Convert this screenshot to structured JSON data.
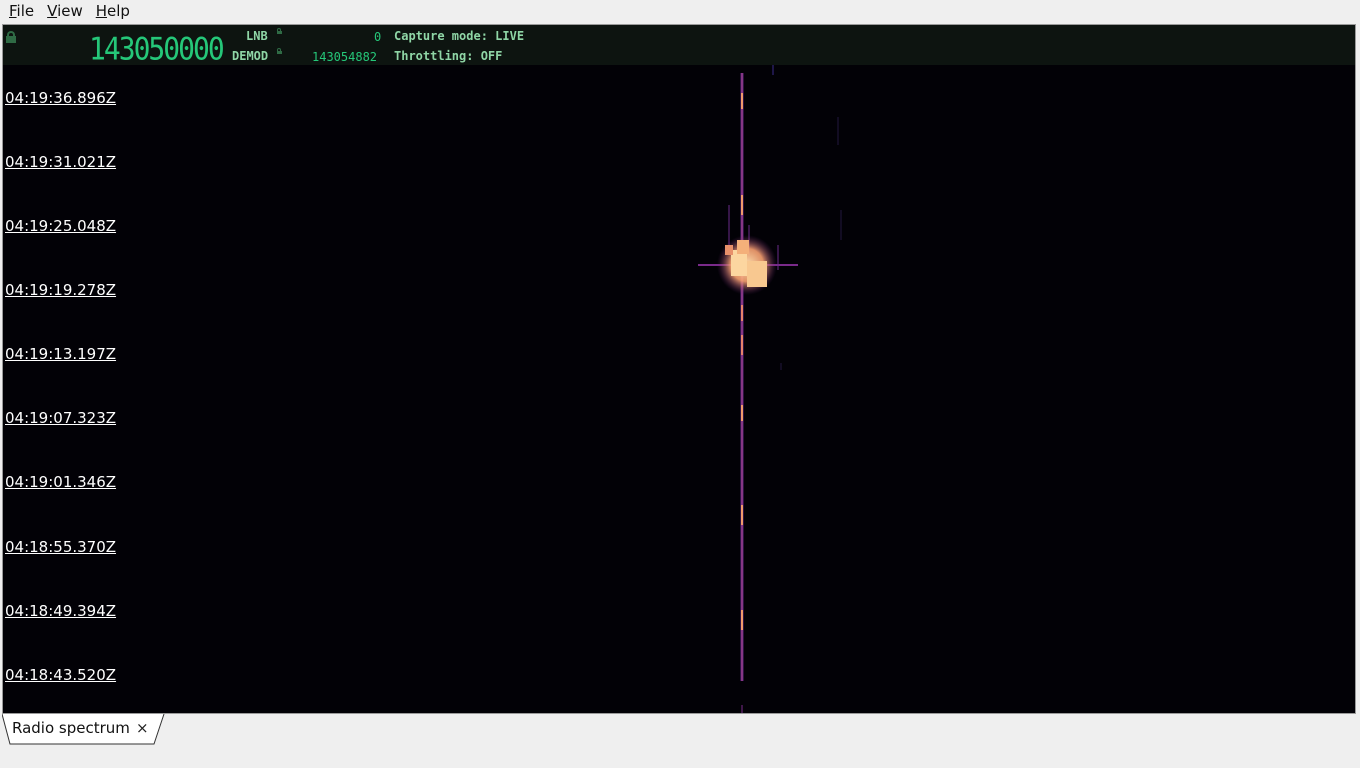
{
  "menu": [
    {
      "mnemonic": "F",
      "rest": "ile"
    },
    {
      "mnemonic": "V",
      "rest": "iew"
    },
    {
      "mnemonic": "H",
      "rest": "elp"
    }
  ],
  "header": {
    "frequency": "143050000",
    "lnb_label": "LNB",
    "lnb_value": "0",
    "demod_label": "DEMOD",
    "demod_value": "143054882",
    "capture_mode": "Capture mode: LIVE",
    "throttling": "Throttling: OFF",
    "lock_color": "#2f6b45"
  },
  "timestamps": [
    "04:19:36.896Z",
    "04:19:31.021Z",
    "04:19:25.048Z",
    "04:19:19.278Z",
    "04:19:13.197Z",
    "04:19:07.323Z",
    "04:19:01.346Z",
    "04:18:55.370Z",
    "04:18:49.394Z",
    "04:18:43.520Z"
  ],
  "tab": {
    "label": "Radio spectrum",
    "close": "×"
  },
  "colors": {
    "background": "#020106",
    "signal_core": "#f29a6a",
    "signal_edge": "#7a2a8a",
    "burst": "#fcd6a0",
    "text_green": "#25c779"
  }
}
